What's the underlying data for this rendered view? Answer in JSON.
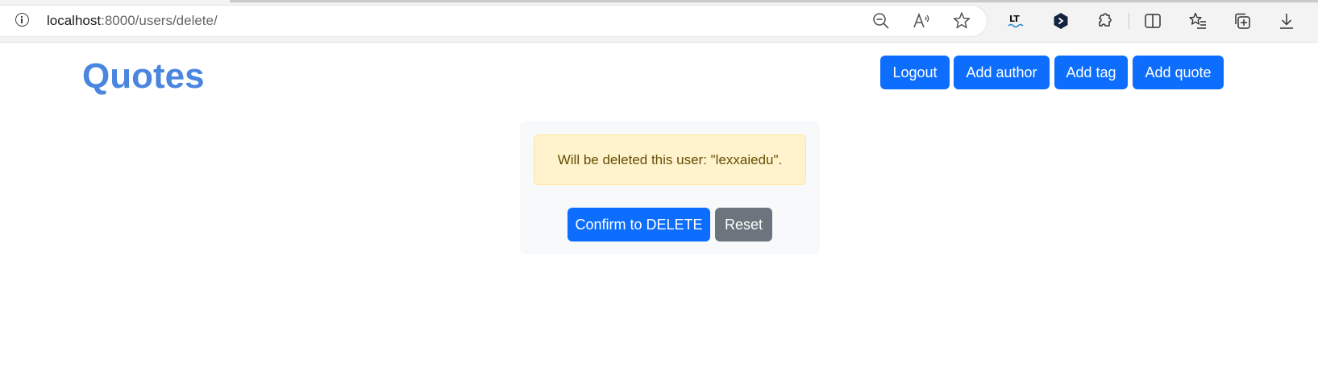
{
  "browser": {
    "url_host": "localhost",
    "url_rest": ":8000/users/delete/",
    "toolbar_icons": [
      "zoom-out-icon",
      "read-aloud-icon",
      "favorite-star-icon"
    ],
    "extension_icons": [
      "languagetool-extension-icon",
      "hex-extension-icon",
      "extensions-puzzle-icon",
      "split-screen-icon",
      "favorites-list-icon",
      "collections-icon",
      "downloads-icon"
    ]
  },
  "header": {
    "title": "Quotes",
    "buttons": {
      "logout": "Logout",
      "add_author": "Add author",
      "add_tag": "Add tag",
      "add_quote": "Add quote"
    }
  },
  "delete_card": {
    "warning_text": "Will be deleted this user: \"lexxaiedu\".",
    "confirm_label": "Confirm to DELETE",
    "reset_label": "Reset"
  },
  "colors": {
    "primary": "#0d6efd",
    "secondary": "#6c757d",
    "title": "#4a86e0",
    "warning_bg": "#fff3cd",
    "warning_text": "#664d03"
  }
}
